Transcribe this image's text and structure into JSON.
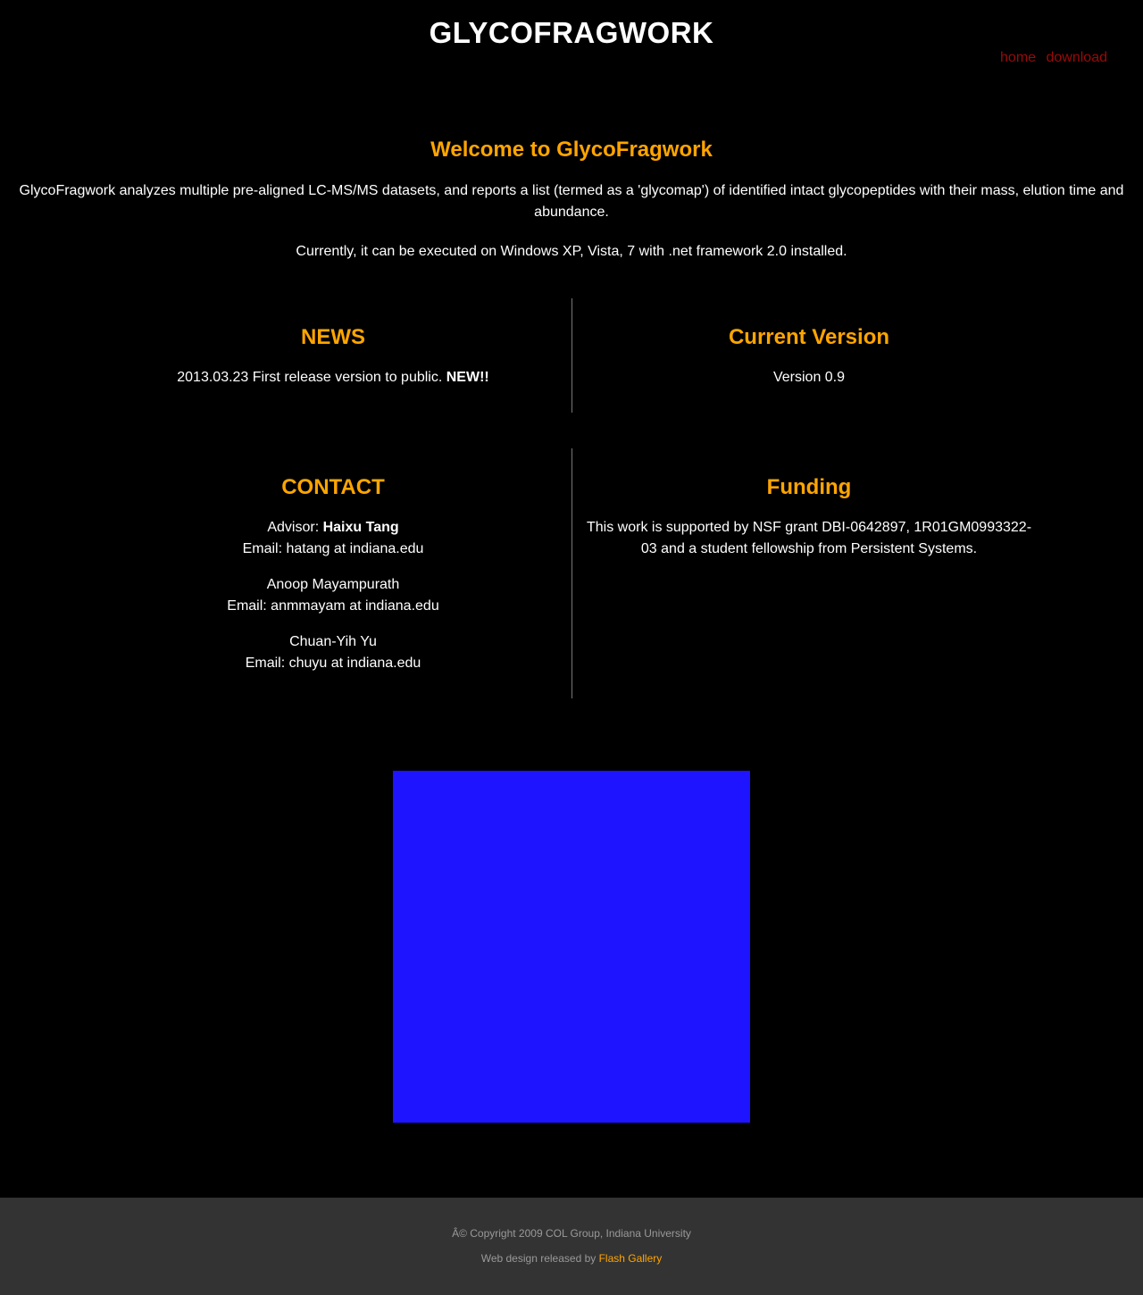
{
  "header": {
    "site_title": "GLYCOFRAGWORK",
    "nav": [
      {
        "label": "home"
      },
      {
        "label": "download"
      }
    ]
  },
  "welcome": {
    "title": "Welcome to GlycoFragwork",
    "paragraph_1": "GlycoFragwork analyzes multiple pre-aligned LC-MS/MS datasets, and reports a list (termed as a 'glycomap') of identified intact glycopeptides with their mass, elution time and abundance.",
    "paragraph_2": "Currently, it can be executed on Windows XP, Vista, 7 with .net framework 2.0 installed."
  },
  "news": {
    "title": "NEWS",
    "item_text": "2013.03.23 First release version to public. ",
    "item_badge": "NEW!!"
  },
  "current_version": {
    "title": "Current Version",
    "text": "Version 0.9"
  },
  "contact": {
    "title": "CONTACT",
    "advisor_prefix": "Advisor: ",
    "advisor_name": "Haixu Tang",
    "advisor_email": "Email: hatang at indiana.edu",
    "people": [
      {
        "name": "Anoop Mayampurath",
        "email": "Email: anmmayam at indiana.edu"
      },
      {
        "name": "Chuan-Yih Yu",
        "email": "Email: chuyu at indiana.edu"
      }
    ]
  },
  "funding": {
    "title": "Funding",
    "text": "This work is supported by NSF grant DBI-0642897, 1R01GM0993322-03 and a student fellowship from Persistent Systems."
  },
  "colors": {
    "background": "#000000",
    "accent": "#ffa500",
    "nav_link": "#9b0a0a",
    "media_block": "#1e14ff",
    "footer_bg": "#333333"
  },
  "footer": {
    "copyright": "Â© Copyright 2009 COL Group, Indiana University",
    "credit_prefix": "Web design released by ",
    "credit_link": "Flash Gallery"
  }
}
